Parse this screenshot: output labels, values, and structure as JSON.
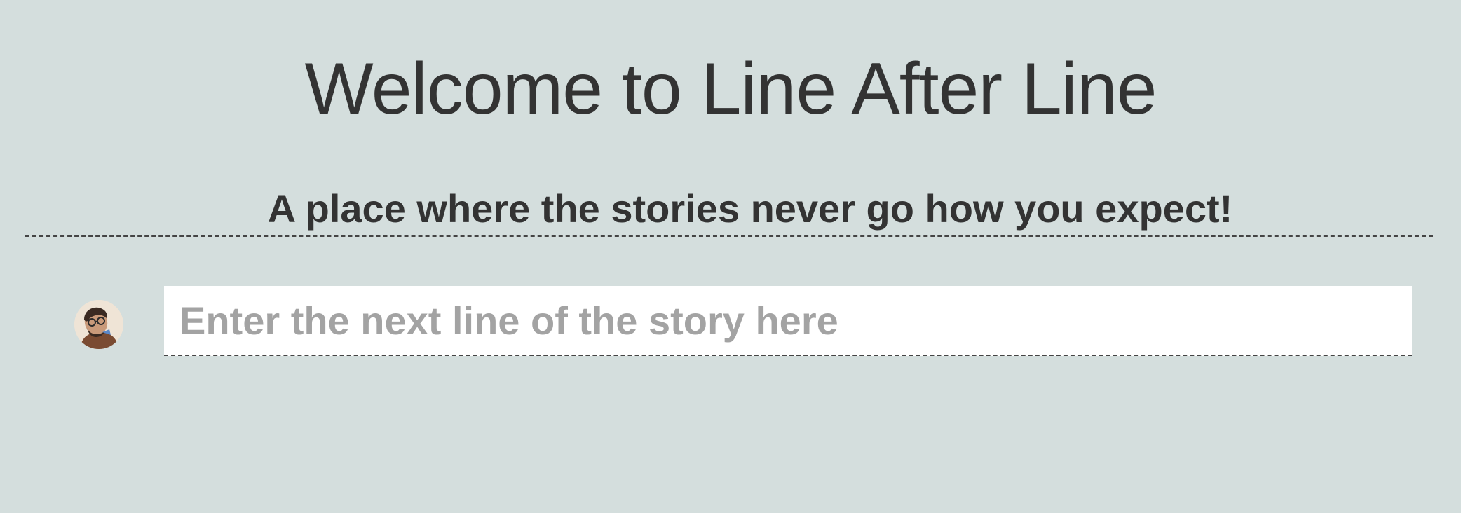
{
  "header": {
    "title": "Welcome to Line After Line",
    "tagline": "A place where the stories never go how you expect!"
  },
  "composer": {
    "avatar_icon": "user-avatar-icon",
    "input_value": "",
    "input_placeholder": "Enter the next line of the story here"
  },
  "colors": {
    "background": "#d4dedd",
    "text": "#333333",
    "placeholder": "#a3a3a3",
    "input_background": "#ffffff",
    "divider": "#444444"
  }
}
